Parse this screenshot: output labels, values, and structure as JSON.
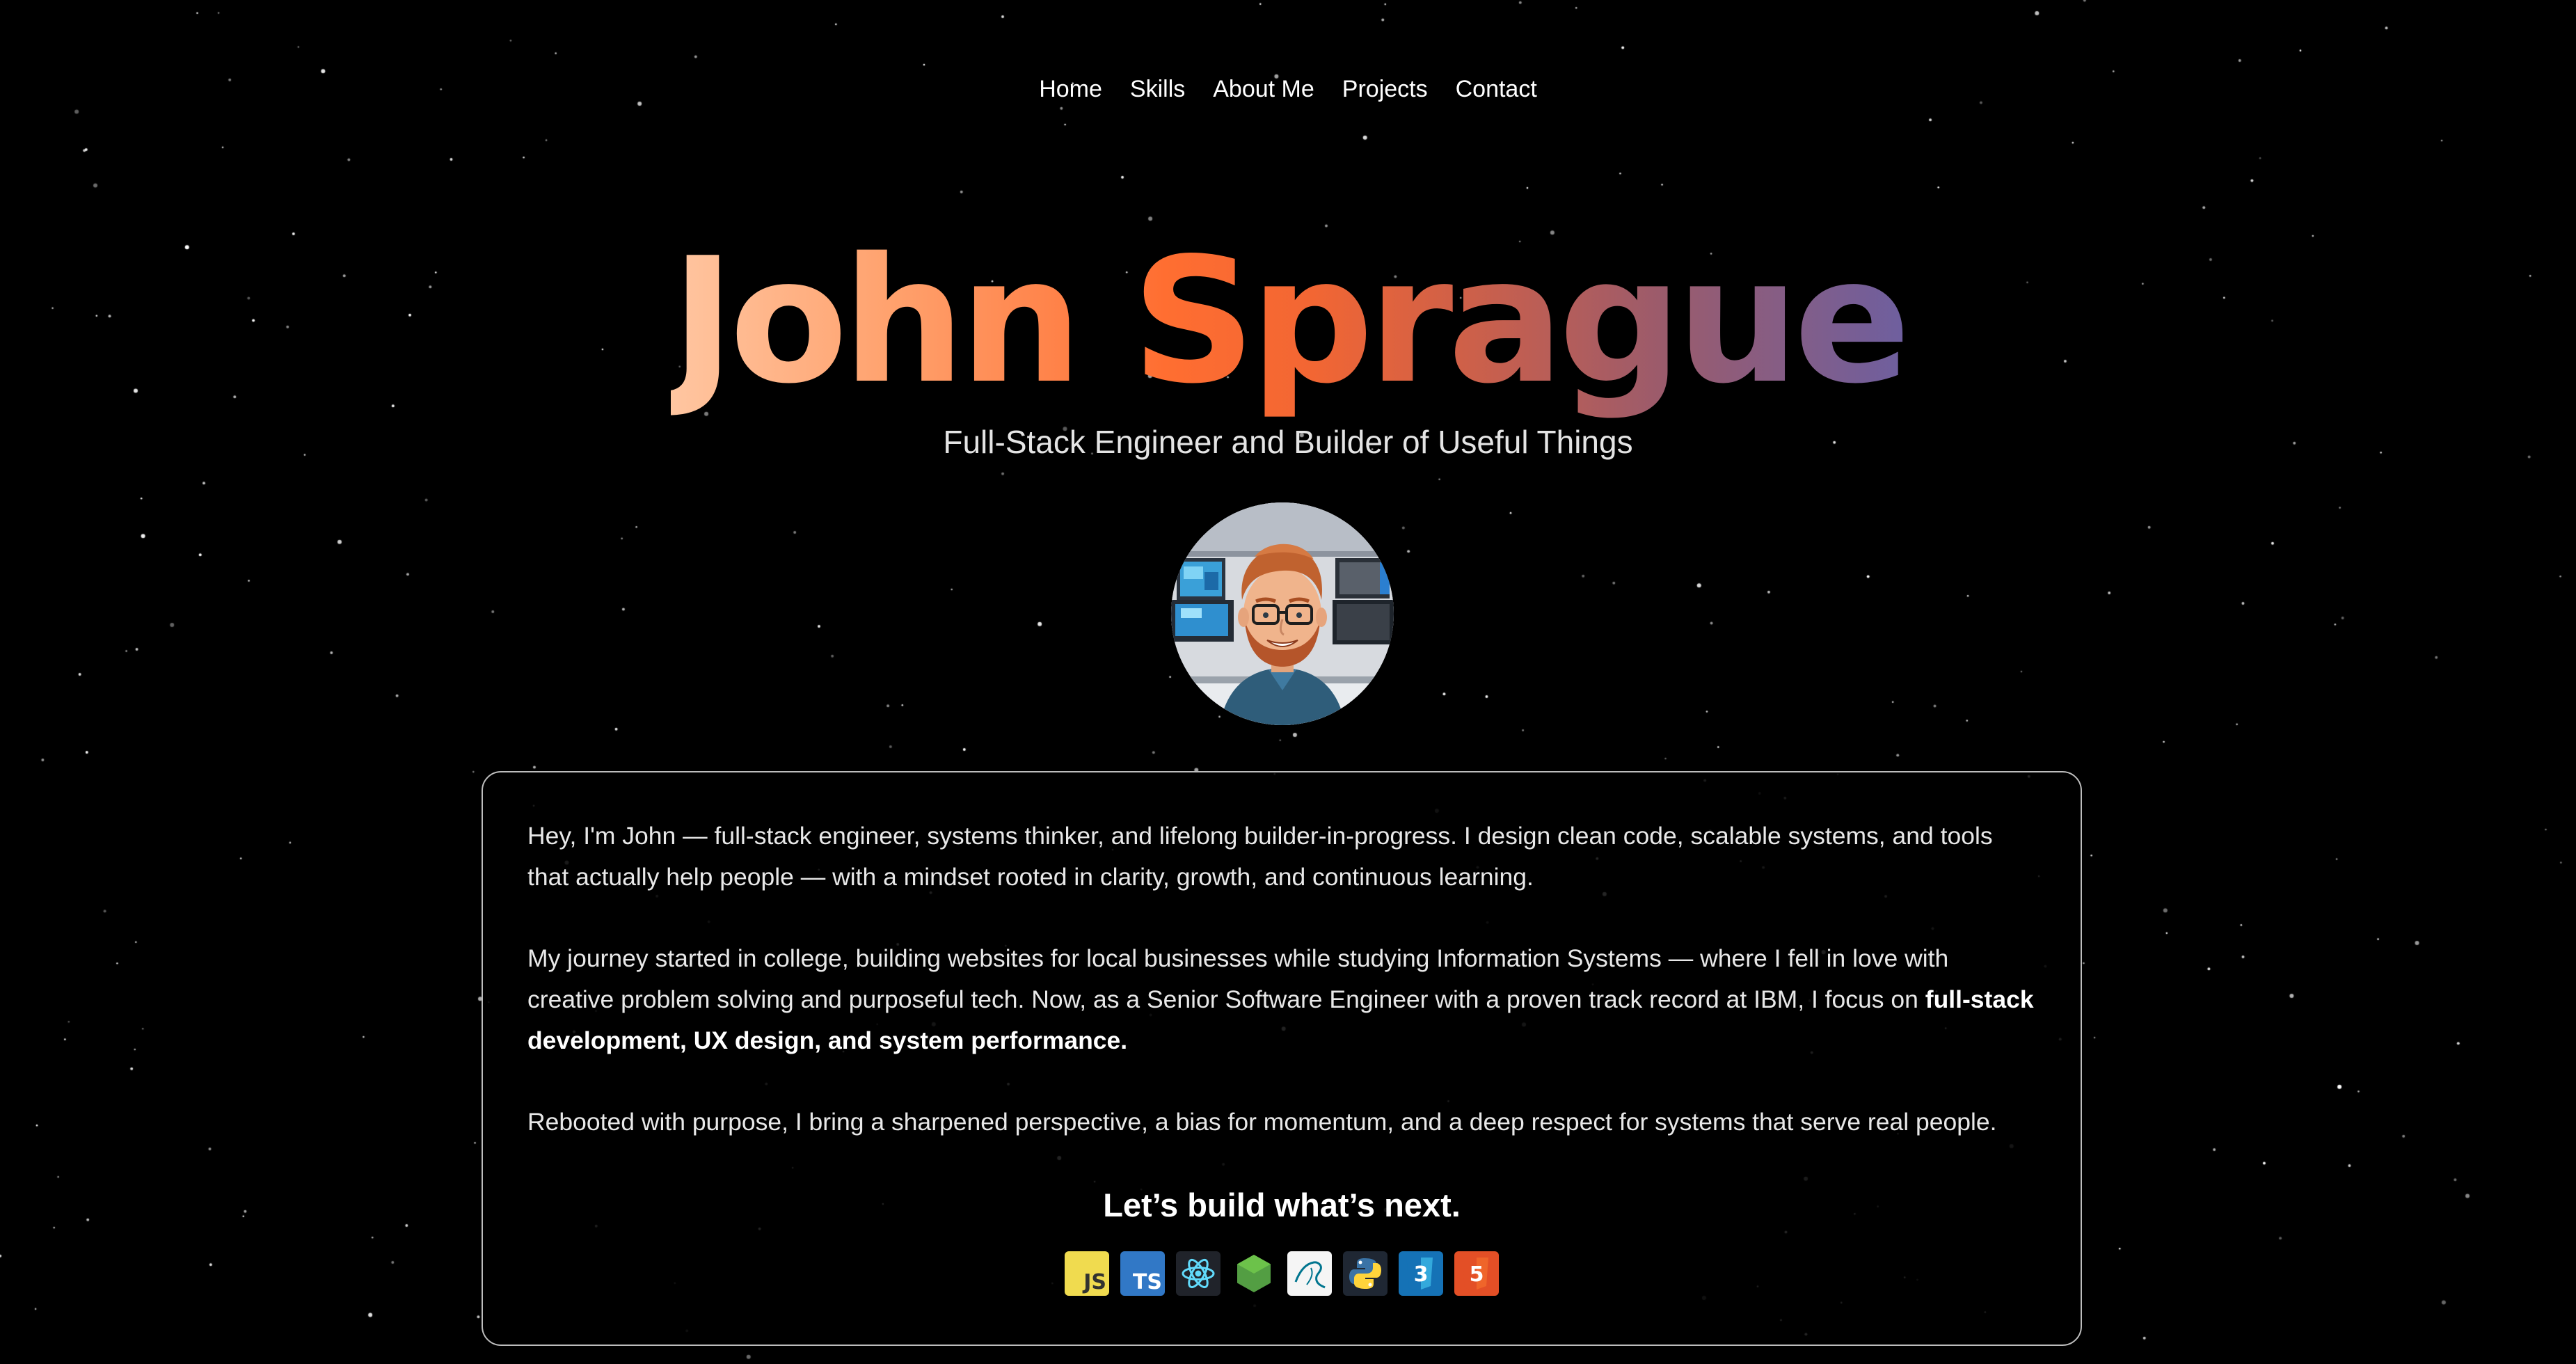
{
  "nav": {
    "items": [
      {
        "label": "Home"
      },
      {
        "label": "Skills"
      },
      {
        "label": "About Me"
      },
      {
        "label": "Projects"
      },
      {
        "label": "Contact"
      }
    ]
  },
  "hero": {
    "name": "John Sprague",
    "subtitle": "Full-Stack Engineer and Builder of Useful Things",
    "avatar_icon": "avatar-portrait"
  },
  "about": {
    "p1": "Hey, I'm John — full-stack engineer, systems thinker, and lifelong builder-in-progress. I design clean code, scalable systems, and tools that actually help people — with a mindset rooted in clarity, growth, and continuous learning.",
    "p2_start": "My journey started in college, building websites for local businesses while studying Information Systems — where I fell in love with creative problem solving and purposeful tech. Now, as a Senior Software Engineer with a proven track record at IBM, I focus on ",
    "p2_bold": "full-stack development, UX design, and system performance.",
    "p3": "Rebooted with purpose, I bring a sharpened perspective, a bias for momentum, and a deep respect for systems that serve real people.",
    "cta": "Let’s build what’s next."
  },
  "tech_icons": [
    {
      "name": "javascript-icon",
      "label": "JS",
      "bg": "#f0db4f",
      "fg": "#323330"
    },
    {
      "name": "typescript-icon",
      "label": "TS",
      "bg": "#3178c6",
      "fg": "#ffffff"
    },
    {
      "name": "react-icon",
      "label": "",
      "bg": "#20232a",
      "fg": "#61dafb"
    },
    {
      "name": "nodejs-icon",
      "label": "",
      "bg": "#000000",
      "fg": "#539e43"
    },
    {
      "name": "mysql-icon",
      "label": "",
      "bg": "#f5f5f5",
      "fg": "#00758f"
    },
    {
      "name": "python-icon",
      "label": "",
      "bg": "#1f2733",
      "fg": "#ffd43b"
    },
    {
      "name": "css3-icon",
      "label": "3",
      "bg": "#1572b6",
      "fg": "#ffffff"
    },
    {
      "name": "html5-icon",
      "label": "5",
      "bg": "#e34f26",
      "fg": "#ffffff"
    }
  ],
  "colors": {
    "background": "#000000",
    "card_border": "#bdbdbd",
    "name_gradient": [
      "#ffc6a1",
      "#ff6e31",
      "#6e5f9f"
    ]
  }
}
